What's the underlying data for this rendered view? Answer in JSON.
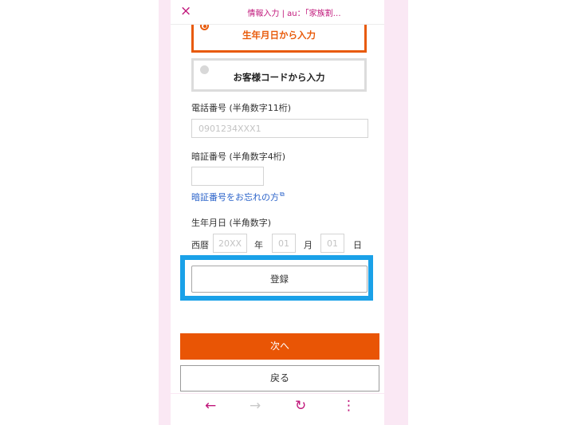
{
  "window": {
    "close_icon": "×",
    "page_title": "情報入力 | au：「家族割…"
  },
  "form": {
    "option_birthdate": "生年月日から入力",
    "option_customer_code": "お客様コードから入力",
    "phone_label": "電話番号 (半角数字11桁)",
    "phone_placeholder": "0901234XXX1",
    "phone_value": "",
    "pin_label": "暗証番号 (半角数字4桁)",
    "pin_value": "",
    "forgot_pin_link": "暗証番号をお忘れの方",
    "birthdate_label": "生年月日 (半角数字)",
    "era_label": "西暦",
    "year_placeholder": "20XX",
    "year_unit": "年",
    "month_placeholder": "01",
    "month_unit": "月",
    "day_placeholder": "01",
    "day_unit": "日"
  },
  "buttons": {
    "register": "登録",
    "next": "次へ",
    "back": "戻る"
  },
  "nav": {
    "back_icon": "←",
    "forward_icon": "→",
    "reload_icon": "↻",
    "menu_icon": "⋮"
  },
  "colors": {
    "accent": "#e95505",
    "brand": "#c0167a",
    "highlight": "#1aa1e8",
    "link": "#2a62c9",
    "nav_disabled": "#c9c9c9"
  }
}
